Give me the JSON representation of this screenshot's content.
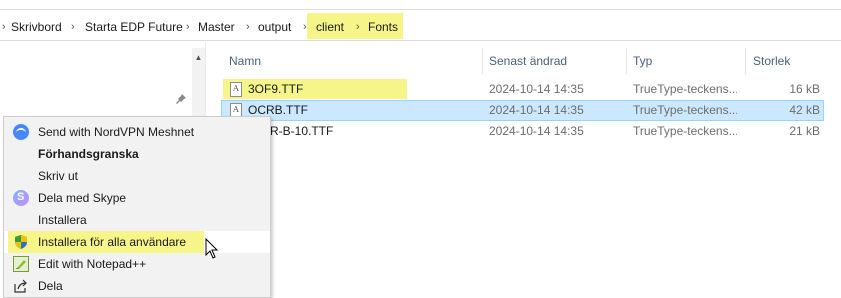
{
  "breadcrumb": {
    "items": [
      "Skrivbord",
      "Starta EDP Future",
      "Master",
      "output",
      "client",
      "Fonts"
    ],
    "separator": "›",
    "highlight_color": "#f5f589"
  },
  "columns": {
    "name": "Namn",
    "modified": "Senast ändrad",
    "type": "Typ",
    "size": "Storlek"
  },
  "files": [
    {
      "name": "3OF9.TTF",
      "modified": "2024-10-14 14:35",
      "type": "TrueType-teckens...",
      "size": "16 kB"
    },
    {
      "name": "OCRB.TTF",
      "modified": "2024-10-14 14:35",
      "type": "TrueType-teckens...",
      "size": "42 kB"
    },
    {
      "name": "OCR-B-10.TTF",
      "visible_name": "R-B-10.TTF",
      "modified": "2024-10-14 14:35",
      "type": "TrueType-teckens...",
      "size": "21 kB"
    }
  ],
  "context_menu": {
    "items": [
      {
        "label": "Send with NordVPN Meshnet",
        "icon": "nordvpn-icon",
        "bold": false
      },
      {
        "label": "Förhandsgranska",
        "icon": "",
        "bold": true
      },
      {
        "label": "Skriv ut",
        "icon": "",
        "bold": false
      },
      {
        "label": "Dela med Skype",
        "icon": "skype-icon",
        "bold": false
      },
      {
        "label": "Installera",
        "icon": "",
        "bold": false
      },
      {
        "label": "Installera för alla användare",
        "icon": "uac-shield-icon",
        "bold": false
      },
      {
        "label": "Edit with Notepad++",
        "icon": "notepad-plus-plus-icon",
        "bold": false
      },
      {
        "label": "Dela",
        "icon": "share-icon",
        "bold": false
      }
    ]
  },
  "colors": {
    "selection_bg": "#cce8ff",
    "selection_border": "#99d1ff",
    "header_text": "#4c607a",
    "highlight": "#f5f589"
  }
}
